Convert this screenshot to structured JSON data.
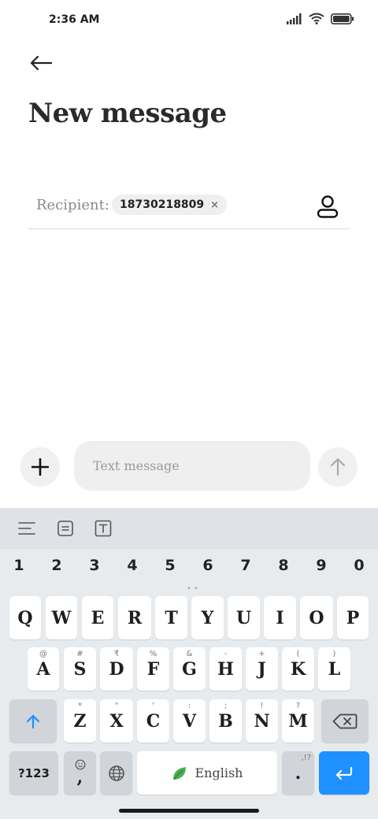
{
  "status": {
    "time": "2:36 AM"
  },
  "header": {
    "title": "New message"
  },
  "recipient": {
    "label": "Recipient:",
    "chip_number": "18730218809",
    "chip_close": "×"
  },
  "compose": {
    "placeholder": "Text message"
  },
  "keyboard": {
    "numbers": [
      "1",
      "2",
      "3",
      "4",
      "5",
      "6",
      "7",
      "8",
      "9",
      "0"
    ],
    "row1": [
      "Q",
      "W",
      "E",
      "R",
      "T",
      "Y",
      "U",
      "I",
      "O",
      "P"
    ],
    "row2": [
      {
        "key": "A",
        "sup": "@"
      },
      {
        "key": "S",
        "sup": "#"
      },
      {
        "key": "D",
        "sup": "₹"
      },
      {
        "key": "F",
        "sup": "%"
      },
      {
        "key": "G",
        "sup": "&"
      },
      {
        "key": "H",
        "sup": "-"
      },
      {
        "key": "J",
        "sup": "+"
      },
      {
        "key": "K",
        "sup": "("
      },
      {
        "key": "L",
        "sup": ")"
      }
    ],
    "row3": [
      {
        "key": "Z",
        "sup": "*"
      },
      {
        "key": "X",
        "sup": "\""
      },
      {
        "key": "C",
        "sup": "'"
      },
      {
        "key": "V",
        "sup": ":"
      },
      {
        "key": "B",
        "sup": ";"
      },
      {
        "key": "N",
        "sup": "!"
      },
      {
        "key": "M",
        "sup": "?"
      }
    ],
    "sym_label": "?123",
    "comma": ",",
    "space_label": "English",
    "period": ".",
    "period_sup": ",!?"
  },
  "colors": {
    "accent": "#1e90ff",
    "keyboard_bg": "#e8ebee",
    "leaf_green": "#4caf50"
  }
}
